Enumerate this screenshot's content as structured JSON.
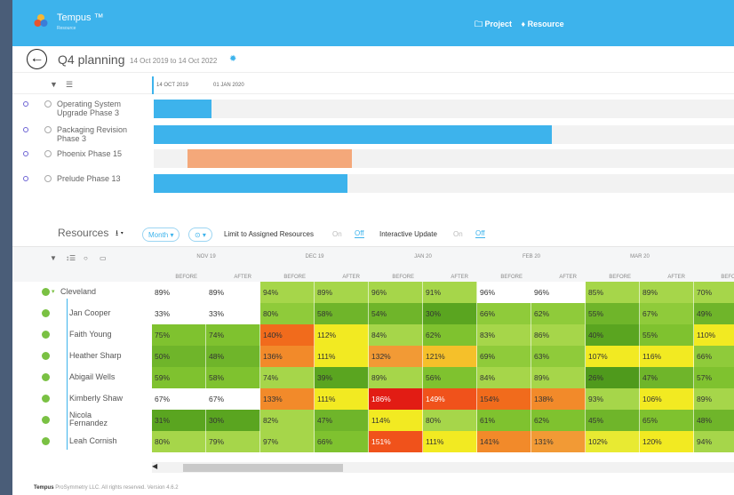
{
  "app": {
    "brand": "Tempus ™",
    "brand_sub": "Resource",
    "nav_project": "🗀 Project",
    "nav_resource": "♦ Resource"
  },
  "project": {
    "title": "Q4 planning",
    "dates": "14 Oct 2019 to 14 Oct 2022"
  },
  "gantt": {
    "date1": "14 OCT 2019",
    "date2": "01 JAN 2020",
    "rows": [
      {
        "name": "Operating System Upgrade Phase 3",
        "color": "#3db3ec"
      },
      {
        "name": "Packaging Revision Phase 3",
        "color": "#3db3ec"
      },
      {
        "name": "Phoenix Phase 15",
        "color": "#f4a87a"
      },
      {
        "name": "Prelude Phase 13",
        "color": "#3db3ec"
      }
    ]
  },
  "resources": {
    "title": "Resources",
    "month_label": "Month ▾",
    "limit_label": "Limit to Assigned Resources",
    "on1": "On",
    "off1": "Off",
    "interactive_label": "Interactive Update",
    "on2": "On",
    "off2": "Off",
    "months": [
      "NOV 19",
      "DEC 19",
      "JAN 20",
      "FEB 20",
      "MAR 20"
    ],
    "before": "BEFORE",
    "after": "AFTER",
    "before_clip": "BEFOR",
    "rows": [
      {
        "name": "Cleveland",
        "cells": [
          [
            "89%",
            "#ffffff"
          ],
          [
            "89%",
            "#ffffff"
          ],
          [
            "94%",
            "#a6d64a"
          ],
          [
            "89%",
            "#a6d64a"
          ],
          [
            "96%",
            "#a6d64a"
          ],
          [
            "91%",
            "#a6d64a"
          ],
          [
            "96%",
            "#ffffff"
          ],
          [
            "96%",
            "#ffffff"
          ],
          [
            "85%",
            "#a6d64a"
          ],
          [
            "89%",
            "#a6d64a"
          ],
          [
            "70%",
            "#a6d64a"
          ]
        ]
      },
      {
        "name": "Jan Cooper",
        "cells": [
          [
            "33%",
            "#ffffff"
          ],
          [
            "33%",
            "#ffffff"
          ],
          [
            "80%",
            "#8fcb3a"
          ],
          [
            "58%",
            "#6fb52a"
          ],
          [
            "54%",
            "#6fb52a"
          ],
          [
            "30%",
            "#5aa520"
          ],
          [
            "66%",
            "#8fcb3a"
          ],
          [
            "62%",
            "#8fcb3a"
          ],
          [
            "55%",
            "#6fb52a"
          ],
          [
            "67%",
            "#8fcb3a"
          ],
          [
            "49%",
            "#6fb52a"
          ]
        ]
      },
      {
        "name": "Faith Young",
        "cells": [
          [
            "75%",
            "#7fc22f"
          ],
          [
            "74%",
            "#7fc22f"
          ],
          [
            "140%",
            "#f16b1c"
          ],
          [
            "112%",
            "#f2ea22"
          ],
          [
            "84%",
            "#a6d64a"
          ],
          [
            "62%",
            "#7fc22f"
          ],
          [
            "83%",
            "#a6d64a"
          ],
          [
            "86%",
            "#a6d64a"
          ],
          [
            "40%",
            "#5aa520"
          ],
          [
            "55%",
            "#7fc22f"
          ],
          [
            "110%",
            "#f2ea22"
          ]
        ]
      },
      {
        "name": "Heather Sharp",
        "cells": [
          [
            "50%",
            "#6fb52a"
          ],
          [
            "48%",
            "#6fb52a"
          ],
          [
            "136%",
            "#f28a2a"
          ],
          [
            "111%",
            "#f2ea22"
          ],
          [
            "132%",
            "#f29a35"
          ],
          [
            "121%",
            "#f5c02a"
          ],
          [
            "69%",
            "#8fcb3a"
          ],
          [
            "63%",
            "#8fcb3a"
          ],
          [
            "107%",
            "#f2ea22"
          ],
          [
            "116%",
            "#f2ea22"
          ],
          [
            "66%",
            "#8fcb3a"
          ]
        ]
      },
      {
        "name": "Abigail Wells",
        "cells": [
          [
            "59%",
            "#7fc22f"
          ],
          [
            "58%",
            "#7fc22f"
          ],
          [
            "74%",
            "#a6d64a"
          ],
          [
            "39%",
            "#5aa520"
          ],
          [
            "89%",
            "#a6d64a"
          ],
          [
            "56%",
            "#7fc22f"
          ],
          [
            "84%",
            "#a6d64a"
          ],
          [
            "89%",
            "#a6d64a"
          ],
          [
            "26%",
            "#4f9a1c"
          ],
          [
            "47%",
            "#6fb52a"
          ],
          [
            "57%",
            "#7fc22f"
          ]
        ]
      },
      {
        "name": "Kimberly Shaw",
        "cells": [
          [
            "67%",
            "#ffffff"
          ],
          [
            "67%",
            "#ffffff"
          ],
          [
            "133%",
            "#f28a2a"
          ],
          [
            "111%",
            "#f2ea22"
          ],
          [
            "186%",
            "#e21c14"
          ],
          [
            "149%",
            "#f0521b"
          ],
          [
            "154%",
            "#f16b1c"
          ],
          [
            "138%",
            "#f28a2a"
          ],
          [
            "93%",
            "#a6d64a"
          ],
          [
            "106%",
            "#f2ea22"
          ],
          [
            "89%",
            "#a6d64a"
          ]
        ]
      },
      {
        "name": "Nicola Fernandez",
        "cells": [
          [
            "31%",
            "#5aa520"
          ],
          [
            "30%",
            "#5aa520"
          ],
          [
            "82%",
            "#a6d64a"
          ],
          [
            "47%",
            "#6fb52a"
          ],
          [
            "114%",
            "#f2ea22"
          ],
          [
            "80%",
            "#a6d64a"
          ],
          [
            "61%",
            "#7fc22f"
          ],
          [
            "62%",
            "#7fc22f"
          ],
          [
            "45%",
            "#6fb52a"
          ],
          [
            "65%",
            "#7fc22f"
          ],
          [
            "48%",
            "#6fb52a"
          ]
        ]
      },
      {
        "name": "Leah Cornish",
        "cells": [
          [
            "80%",
            "#a6d64a"
          ],
          [
            "79%",
            "#a6d64a"
          ],
          [
            "97%",
            "#a6d64a"
          ],
          [
            "66%",
            "#7fc22f"
          ],
          [
            "151%",
            "#f0521b"
          ],
          [
            "111%",
            "#f2ea22"
          ],
          [
            "141%",
            "#f28a2a"
          ],
          [
            "131%",
            "#f29a35"
          ],
          [
            "102%",
            "#e8ea32"
          ],
          [
            "120%",
            "#f2ea22"
          ],
          [
            "94%",
            "#a6d64a"
          ]
        ]
      }
    ]
  },
  "footer": {
    "brand": "Tempus",
    "text": "ProSymmetry LLC. All rights reserved. Version 4.6.2"
  }
}
